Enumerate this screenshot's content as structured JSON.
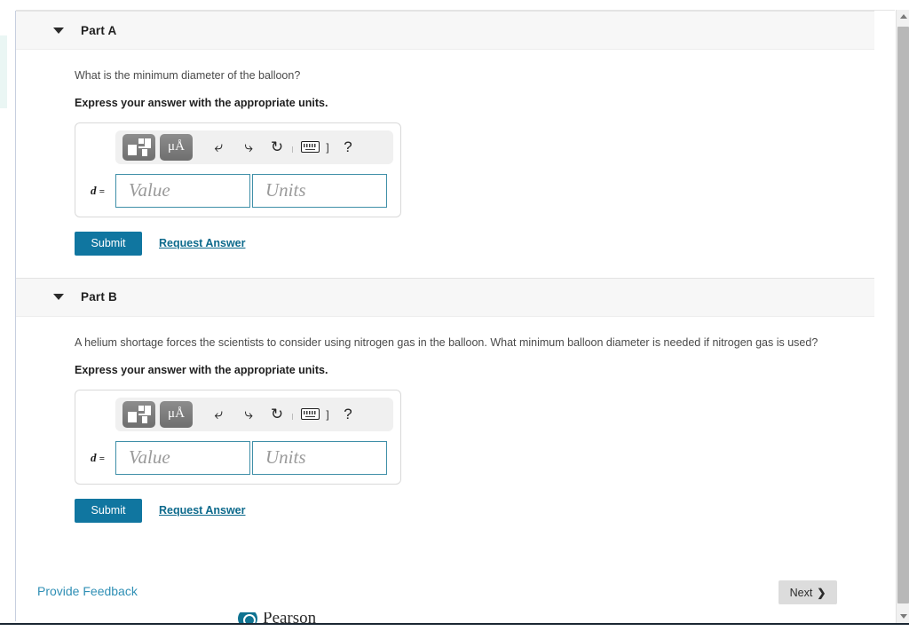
{
  "parts": [
    {
      "caret": "caret-down-icon",
      "title": "Part A",
      "question": "What is the minimum diameter of the balloon?",
      "express": "Express your answer with the appropriate units.",
      "answer": {
        "variable": "d",
        "equals": "=",
        "value_placeholder": "Value",
        "units_placeholder": "Units",
        "value": "",
        "units": ""
      },
      "toolbar": {
        "template_icon": "template-icon",
        "units_icon": "μÅ",
        "units_mu": "μ",
        "units_angstrom": "A",
        "undo": "⬅",
        "redo": "➡",
        "reset": "↻",
        "keyboard": "keyboard-icon",
        "bracket": "]",
        "help": "?"
      },
      "submit_label": "Submit",
      "request_answer_label": "Request Answer"
    },
    {
      "caret": "caret-down-icon",
      "title": "Part B",
      "question": "A helium shortage forces the scientists to consider using nitrogen gas in the balloon. What minimum balloon diameter is needed if nitrogen gas is used?",
      "express": "Express your answer with the appropriate units.",
      "answer": {
        "variable": "d",
        "equals": "=",
        "value_placeholder": "Value",
        "units_placeholder": "Units",
        "value": "",
        "units": ""
      },
      "toolbar": {
        "template_icon": "template-icon",
        "units_icon": "μÅ",
        "units_mu": "μ",
        "units_angstrom": "A",
        "undo": "⬅",
        "redo": "➡",
        "reset": "↻",
        "keyboard": "keyboard-icon",
        "bracket": "]",
        "help": "?"
      },
      "submit_label": "Submit",
      "request_answer_label": "Request Answer"
    }
  ],
  "footer": {
    "provide_feedback_label": "Provide Feedback",
    "next_label": "Next",
    "next_chevron": "❯"
  },
  "branding": {
    "name": "Pearson"
  },
  "colors": {
    "submit_blue": "#1076a0",
    "link_teal": "#0d6a8c",
    "feedback_teal": "#2f8fb5",
    "field_border": "#3f8fa8",
    "header_bg": "#f7f7f7",
    "next_bg": "#dcdcdc"
  }
}
